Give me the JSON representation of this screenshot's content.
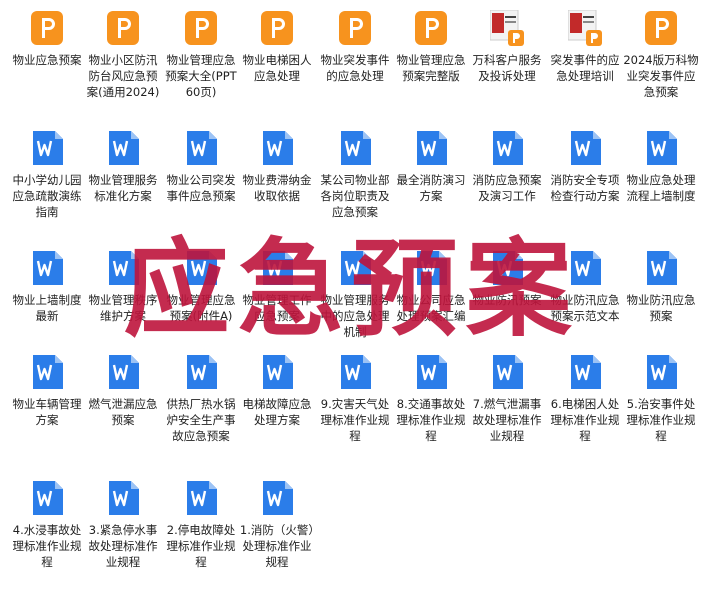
{
  "overlay_text": "应急预案",
  "colors": {
    "pdf": "#f7931e",
    "word": "#2b7de9",
    "overlay": "#be143c"
  },
  "files": [
    {
      "label": "物业应急预案",
      "icon": "pdf-icon"
    },
    {
      "label": "物业小区防汛防台风应急预案(通用2024)",
      "icon": "pdf-icon"
    },
    {
      "label": "物业管理应急预案大全(PPT60页)",
      "icon": "pdf-icon"
    },
    {
      "label": "物业电梯困人应急处理",
      "icon": "pdf-icon"
    },
    {
      "label": "物业突发事件的应急处理",
      "icon": "pdf-icon"
    },
    {
      "label": "物业管理应急预案完整版",
      "icon": "pdf-icon"
    },
    {
      "label": "万科客户服务及投诉处理",
      "icon": "pdf-thumb-icon"
    },
    {
      "label": "突发事件的应急处理培训",
      "icon": "pdf-thumb-icon"
    },
    {
      "label": "2024版万科物业突发事件应急预案",
      "icon": "pdf-icon"
    },
    {
      "label": "中小学幼儿园应急疏散演练指南",
      "icon": "word-icon"
    },
    {
      "label": "物业管理服务标准化方案",
      "icon": "word-icon"
    },
    {
      "label": "物业公司突发事件应急预案",
      "icon": "word-icon"
    },
    {
      "label": "物业费滞纳金收取依据",
      "icon": "word-icon"
    },
    {
      "label": "某公司物业部各岗位职责及应急预案",
      "icon": "word-icon"
    },
    {
      "label": "最全消防演习方案",
      "icon": "word-icon"
    },
    {
      "label": "消防应急预案及演习工作",
      "icon": "word-icon"
    },
    {
      "label": "消防安全专项检查行动方案",
      "icon": "word-icon"
    },
    {
      "label": "物业应急处理流程上墙制度",
      "icon": "word-icon"
    },
    {
      "label": "物业上墙制度最新",
      "icon": "word-icon"
    },
    {
      "label": "物业管理秩序维护方案",
      "icon": "word-icon"
    },
    {
      "label": "物业管理应急预案(附件A)",
      "icon": "word-icon"
    },
    {
      "label": "物业管理工作应急预案",
      "icon": "word-icon"
    },
    {
      "label": "物业管理服务中的应急处理机制",
      "icon": "word-icon"
    },
    {
      "label": "物业公司应急处理预案汇编",
      "icon": "word-icon"
    },
    {
      "label": "物业防汛预案",
      "icon": "word-icon"
    },
    {
      "label": "物业防汛应急预案示范文本",
      "icon": "word-icon"
    },
    {
      "label": "物业防汛应急预案",
      "icon": "word-icon"
    },
    {
      "label": "物业车辆管理方案",
      "icon": "word-icon"
    },
    {
      "label": "燃气泄漏应急预案",
      "icon": "word-icon"
    },
    {
      "label": "供热厂热水锅炉安全生产事故应急预案",
      "icon": "word-icon"
    },
    {
      "label": "电梯故障应急处理方案",
      "icon": "word-icon"
    },
    {
      "label": "9.灾害天气处理标准作业规程",
      "icon": "word-icon"
    },
    {
      "label": "8.交通事故处理标准作业规程",
      "icon": "word-icon"
    },
    {
      "label": "7.燃气泄漏事故处理标准作业规程",
      "icon": "word-icon"
    },
    {
      "label": "6.电梯困人处理标准作业规程",
      "icon": "word-icon"
    },
    {
      "label": "5.治安事件处理标准作业规程",
      "icon": "word-icon"
    },
    {
      "label": "4.水浸事故处理标准作业规程",
      "icon": "word-icon"
    },
    {
      "label": "3.紧急停水事故处理标准作业规程",
      "icon": "word-icon"
    },
    {
      "label": "2.停电故障处理标准作业规程",
      "icon": "word-icon"
    },
    {
      "label": "1.消防（火警）处理标准作业规程",
      "icon": "word-icon"
    }
  ]
}
